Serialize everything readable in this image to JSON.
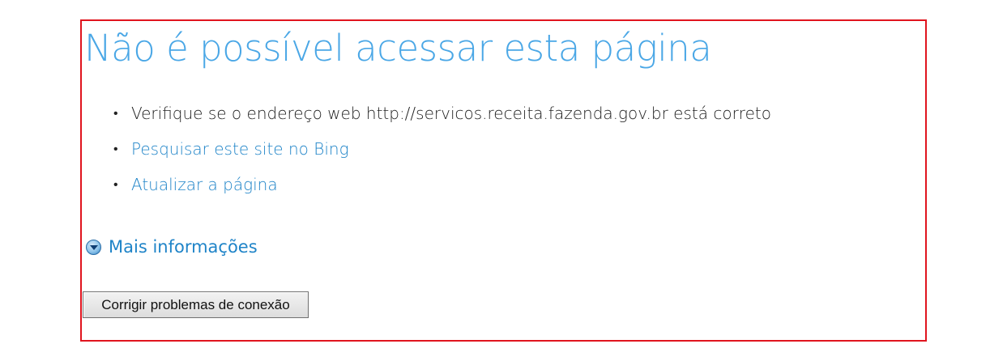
{
  "page": {
    "title": "Não é possível acessar esta página"
  },
  "suggestions": [
    {
      "text": "Verifique se o endereço web http://servicos.receita.fazenda.gov.br está correto",
      "link": false
    },
    {
      "text": "Pesquisar este site no Bing",
      "link": true
    },
    {
      "text": "Atualizar a página",
      "link": true
    }
  ],
  "more_info": {
    "label": "Mais informações",
    "icon": "expand-circle-icon"
  },
  "fix_button": {
    "label": "Corrigir problemas de conexão"
  },
  "colors": {
    "frame_border": "#e0141e",
    "title": "#4aa7e6",
    "link": "#1f84c8",
    "text": "#222222"
  }
}
